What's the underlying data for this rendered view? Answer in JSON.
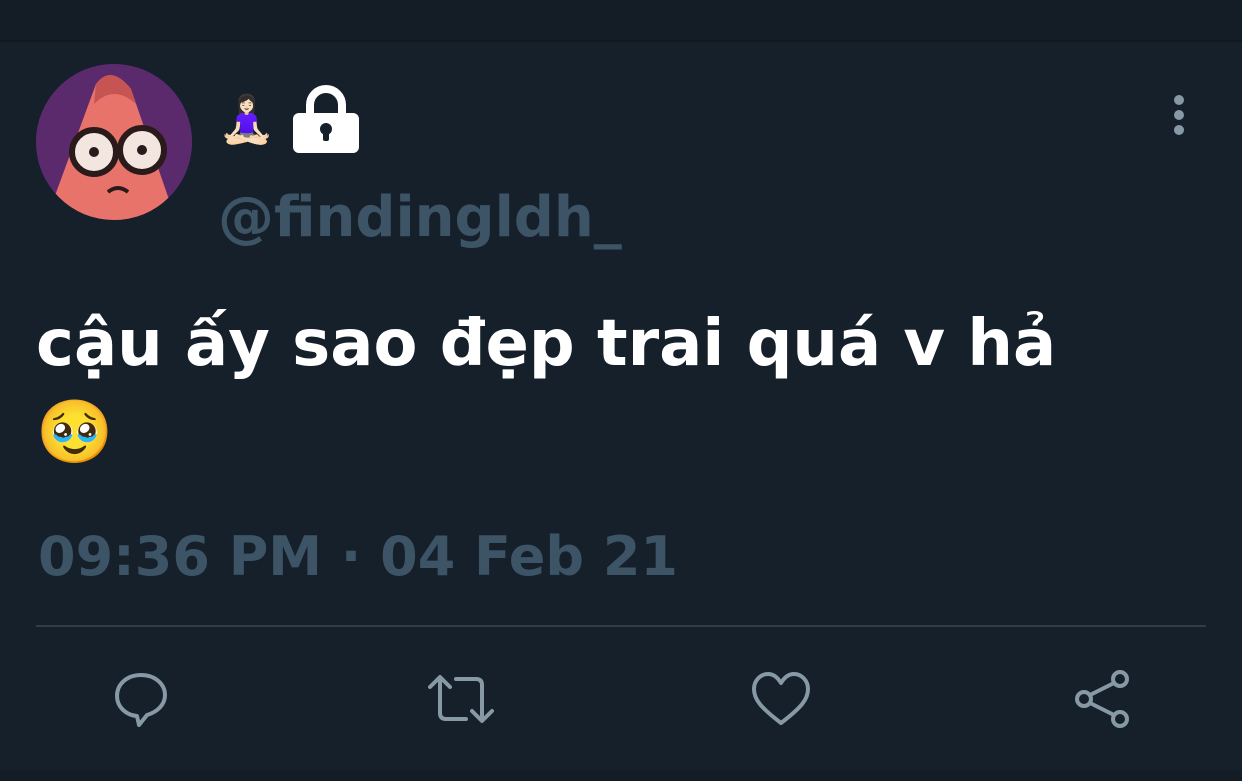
{
  "user": {
    "display_emoji": "🧘🏻‍♀️",
    "handle": "@findingldh_",
    "avatar_icon": "avatar-cartoon-icon",
    "protected_icon": "lock-icon"
  },
  "tweet": {
    "text": "cậu ấy sao đẹp trai quá v hả",
    "emoji": "🥹",
    "timestamp": "09:36 PM · 04 Feb 21"
  },
  "actions": [
    {
      "name": "reply",
      "icon": "reply-icon"
    },
    {
      "name": "retweet",
      "icon": "retweet-icon"
    },
    {
      "name": "like",
      "icon": "heart-icon"
    },
    {
      "name": "share",
      "icon": "share-icon"
    }
  ],
  "colors": {
    "background": "#15202b",
    "text_primary": "#ffffff",
    "text_secondary": "#3d5466",
    "icon": "#8899a6",
    "divider": "#2f3d4a"
  }
}
